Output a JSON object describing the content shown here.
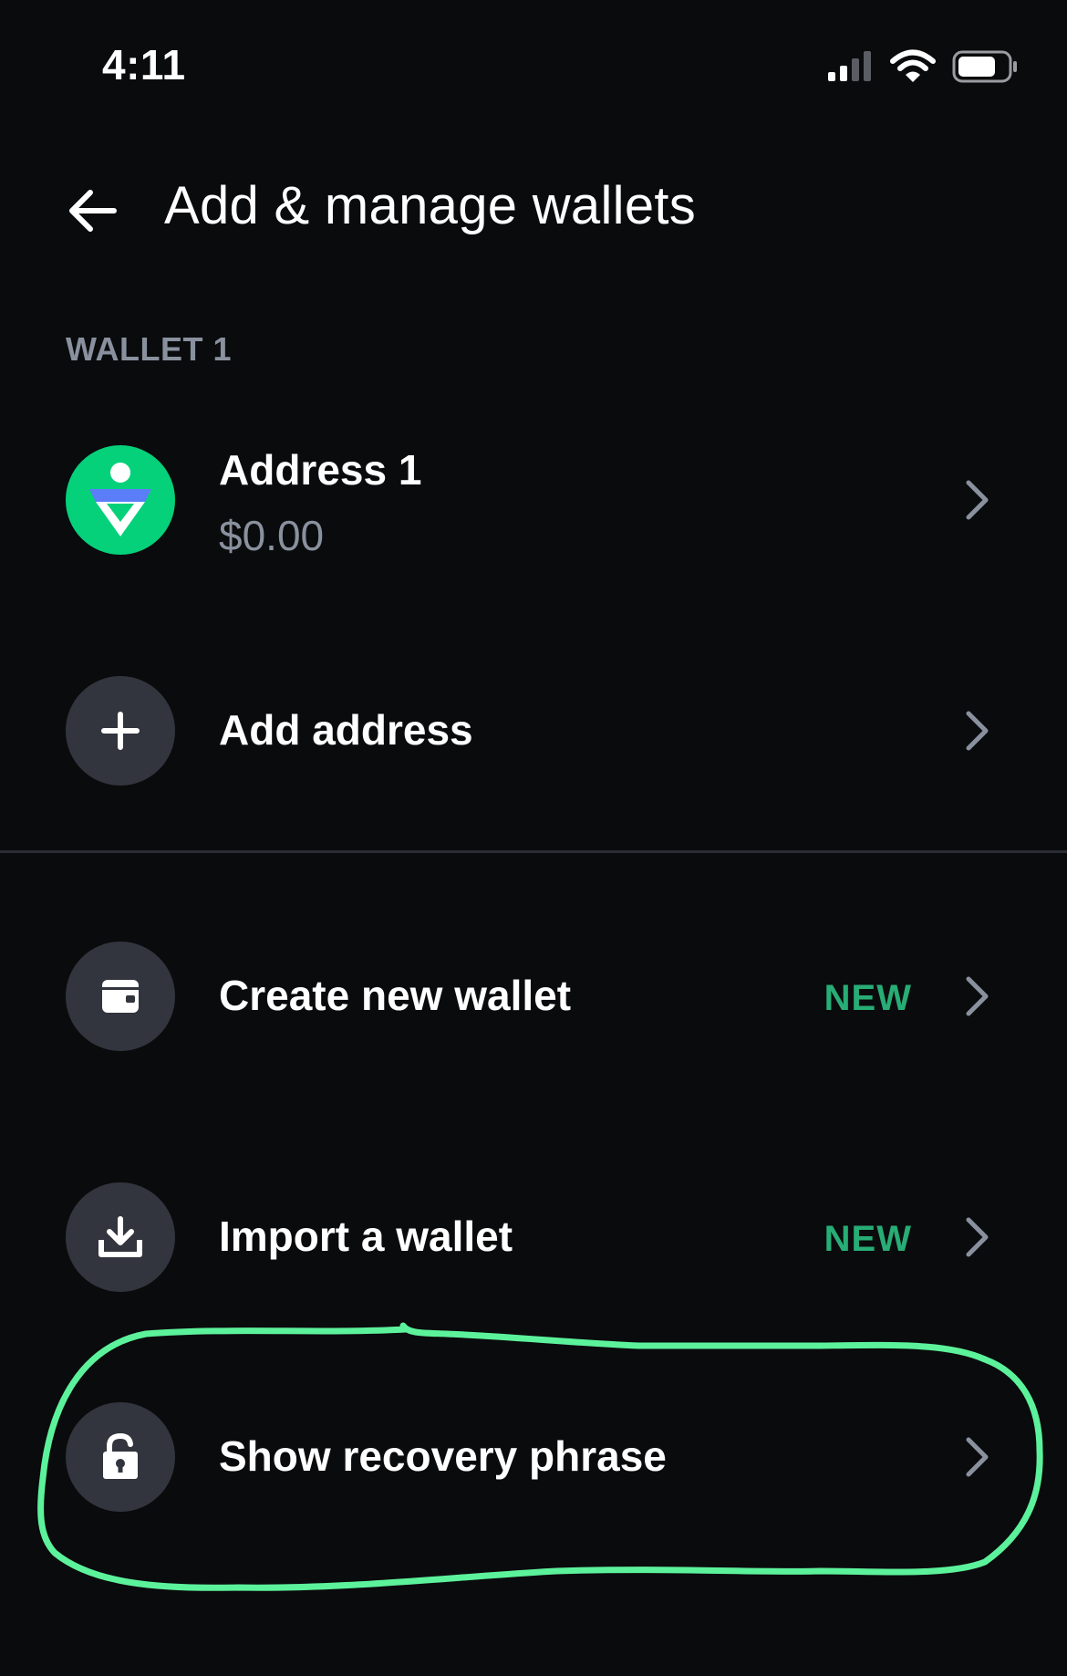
{
  "status_bar": {
    "time": "4:11",
    "icons": [
      "cellular-signal-icon",
      "wifi-icon",
      "battery-icon"
    ]
  },
  "header": {
    "back_icon": "arrow-left-icon",
    "title": "Add & manage wallets"
  },
  "wallet_section": {
    "label": "WALLET 1",
    "address": {
      "name": "Address 1",
      "balance": "$0.00",
      "icon": "wallet-avatar-icon"
    },
    "add_address": {
      "label": "Add address",
      "icon": "plus-icon"
    }
  },
  "actions": [
    {
      "label": "Create new wallet",
      "badge": "NEW",
      "icon": "wallet-icon"
    },
    {
      "label": "Import a wallet",
      "badge": "NEW",
      "icon": "download-icon"
    },
    {
      "label": "Show recovery phrase",
      "badge": "",
      "icon": "unlock-icon"
    }
  ],
  "colors": {
    "background": "#0a0b0d",
    "badge_green": "#27ad75",
    "icon_circle": "#32353d",
    "muted_text": "#8a919e",
    "annotation_green": "#5cf29b",
    "avatar_green": "#05d17b",
    "avatar_blue": "#5b7ef8"
  }
}
